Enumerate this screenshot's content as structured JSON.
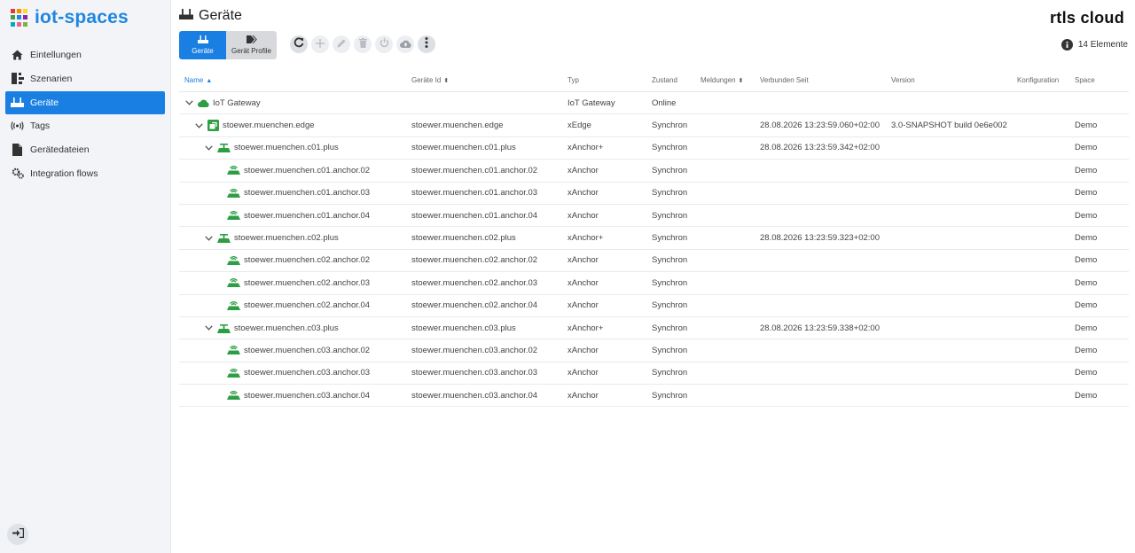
{
  "brand": {
    "name": "iot-spaces",
    "colors": [
      "#e53935",
      "#fb8c00",
      "#fdd835",
      "#43a047",
      "#1e88e5",
      "#8e24aa",
      "#00acc1",
      "#f06292",
      "#7cb342"
    ]
  },
  "sidebar": {
    "items": [
      {
        "label": "Eintellungen",
        "icon": "home-icon",
        "active": false
      },
      {
        "label": "Szenarien",
        "icon": "scenarios-icon",
        "active": false
      },
      {
        "label": "Geräte",
        "icon": "router-icon",
        "active": true
      },
      {
        "label": "Tags",
        "icon": "broadcast-icon",
        "active": false
      },
      {
        "label": "Gerätedateien",
        "icon": "file-icon",
        "active": false
      },
      {
        "label": "Integration flows",
        "icon": "cogs-icon",
        "active": false
      }
    ]
  },
  "header": {
    "title": "Geräte",
    "logo_text": "rtls cloud",
    "count_text": "14 Elemente"
  },
  "toggle": {
    "devices_label": "Geräte",
    "profiles_label": "Gerät Profile"
  },
  "columns": {
    "name": "Name",
    "id": "Geräte Id",
    "typ": "Typ",
    "zustand": "Zustand",
    "meldungen": "Meldungen",
    "verbunden": "Verbunden Seit",
    "version": "Version",
    "konfiguration": "Konfiguration",
    "space": "Space"
  },
  "rows": [
    {
      "level": 0,
      "chevron": true,
      "icon": "cloud-icon",
      "name": "IoT Gateway",
      "id": "",
      "typ": "IoT Gateway",
      "zustand": "Online",
      "verbunden": "",
      "version": "",
      "space": ""
    },
    {
      "level": 1,
      "chevron": true,
      "icon": "edge-icon",
      "name": "stoewer.muenchen.edge",
      "id": "stoewer.muenchen.edge",
      "typ": "xEdge",
      "zustand": "Synchron",
      "verbunden": "28.08.2026 13:23:59.060+02:00",
      "version": "3.0-SNAPSHOT build 0e6e002",
      "space": "Demo"
    },
    {
      "level": 2,
      "chevron": true,
      "icon": "anchor-plus-icon",
      "name": "stoewer.muenchen.c01.plus",
      "id": "stoewer.muenchen.c01.plus",
      "typ": "xAnchor+",
      "zustand": "Synchron",
      "verbunden": "28.08.2026 13:23:59.342+02:00",
      "version": "",
      "space": "Demo"
    },
    {
      "level": 3,
      "chevron": false,
      "icon": "anchor-icon",
      "name": "stoewer.muenchen.c01.anchor.02",
      "id": "stoewer.muenchen.c01.anchor.02",
      "typ": "xAnchor",
      "zustand": "Synchron",
      "verbunden": "",
      "version": "",
      "space": "Demo"
    },
    {
      "level": 3,
      "chevron": false,
      "icon": "anchor-icon",
      "name": "stoewer.muenchen.c01.anchor.03",
      "id": "stoewer.muenchen.c01.anchor.03",
      "typ": "xAnchor",
      "zustand": "Synchron",
      "verbunden": "",
      "version": "",
      "space": "Demo"
    },
    {
      "level": 3,
      "chevron": false,
      "icon": "anchor-icon",
      "name": "stoewer.muenchen.c01.anchor.04",
      "id": "stoewer.muenchen.c01.anchor.04",
      "typ": "xAnchor",
      "zustand": "Synchron",
      "verbunden": "",
      "version": "",
      "space": "Demo"
    },
    {
      "level": 2,
      "chevron": true,
      "icon": "anchor-plus-icon",
      "name": "stoewer.muenchen.c02.plus",
      "id": "stoewer.muenchen.c02.plus",
      "typ": "xAnchor+",
      "zustand": "Synchron",
      "verbunden": "28.08.2026 13:23:59.323+02:00",
      "version": "",
      "space": "Demo"
    },
    {
      "level": 3,
      "chevron": false,
      "icon": "anchor-icon",
      "name": "stoewer.muenchen.c02.anchor.02",
      "id": "stoewer.muenchen.c02.anchor.02",
      "typ": "xAnchor",
      "zustand": "Synchron",
      "verbunden": "",
      "version": "",
      "space": "Demo"
    },
    {
      "level": 3,
      "chevron": false,
      "icon": "anchor-icon",
      "name": "stoewer.muenchen.c02.anchor.03",
      "id": "stoewer.muenchen.c02.anchor.03",
      "typ": "xAnchor",
      "zustand": "Synchron",
      "verbunden": "",
      "version": "",
      "space": "Demo"
    },
    {
      "level": 3,
      "chevron": false,
      "icon": "anchor-icon",
      "name": "stoewer.muenchen.c02.anchor.04",
      "id": "stoewer.muenchen.c02.anchor.04",
      "typ": "xAnchor",
      "zustand": "Synchron",
      "verbunden": "",
      "version": "",
      "space": "Demo"
    },
    {
      "level": 2,
      "chevron": true,
      "icon": "anchor-plus-icon",
      "name": "stoewer.muenchen.c03.plus",
      "id": "stoewer.muenchen.c03.plus",
      "typ": "xAnchor+",
      "zustand": "Synchron",
      "verbunden": "28.08.2026 13:23:59.338+02:00",
      "version": "",
      "space": "Demo"
    },
    {
      "level": 3,
      "chevron": false,
      "icon": "anchor-icon",
      "name": "stoewer.muenchen.c03.anchor.02",
      "id": "stoewer.muenchen.c03.anchor.02",
      "typ": "xAnchor",
      "zustand": "Synchron",
      "verbunden": "",
      "version": "",
      "space": "Demo"
    },
    {
      "level": 3,
      "chevron": false,
      "icon": "anchor-icon",
      "name": "stoewer.muenchen.c03.anchor.03",
      "id": "stoewer.muenchen.c03.anchor.03",
      "typ": "xAnchor",
      "zustand": "Synchron",
      "verbunden": "",
      "version": "",
      "space": "Demo"
    },
    {
      "level": 3,
      "chevron": false,
      "icon": "anchor-icon",
      "name": "stoewer.muenchen.c03.anchor.04",
      "id": "stoewer.muenchen.c03.anchor.04",
      "typ": "xAnchor",
      "zustand": "Synchron",
      "verbunden": "",
      "version": "",
      "space": "Demo"
    }
  ],
  "colors": {
    "accent": "#1a7fe2",
    "device_green": "#2e9e44"
  }
}
